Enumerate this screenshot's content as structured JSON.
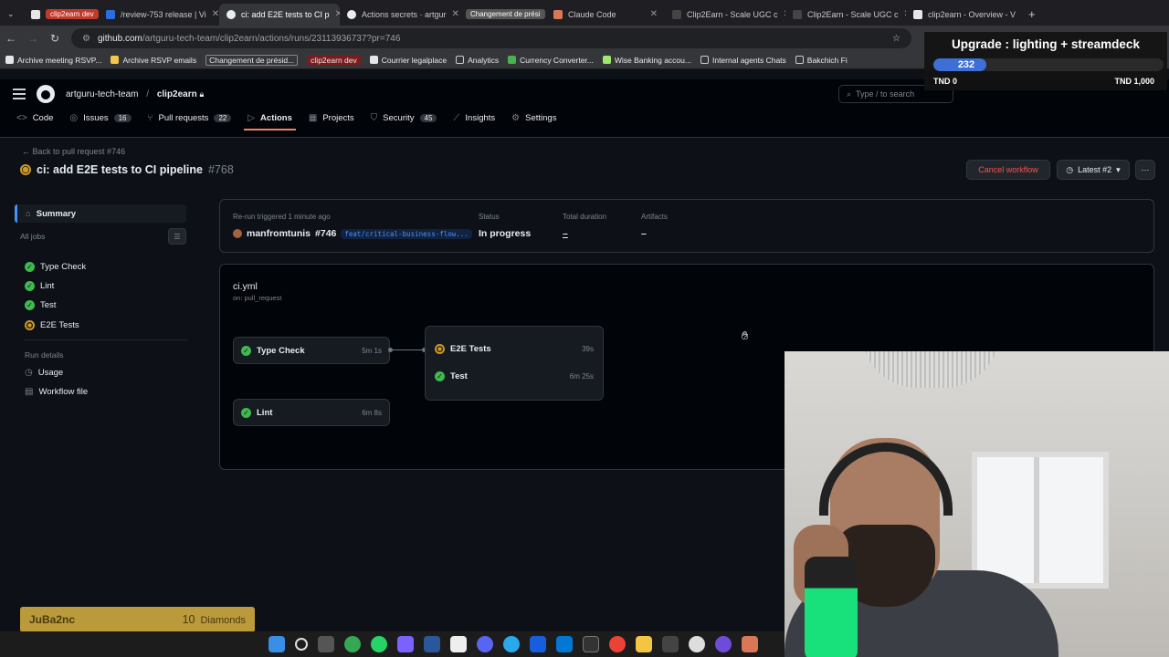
{
  "browser": {
    "tabs": [
      {
        "label": "clip2earn dev",
        "kind": "pill",
        "color": "#c0392b"
      },
      {
        "label": "/review-753 release | Vi",
        "kind": "tab",
        "color": "#2d6cdf"
      },
      {
        "label": "ci: add E2E tests to CI p",
        "kind": "active",
        "color": "#e6edf3"
      },
      {
        "label": "Actions secrets · artgur",
        "kind": "tab",
        "color": "#e6edf3"
      },
      {
        "label": "Changement de prési",
        "kind": "pill",
        "color": "#555"
      },
      {
        "label": "Claude Code",
        "kind": "tab",
        "color": "#d97757"
      },
      {
        "label": "Clip2Earn - Scale UGC c",
        "kind": "tab",
        "color": "#111"
      },
      {
        "label": "Clip2Earn - Scale UGC c",
        "kind": "tab",
        "color": "#111"
      },
      {
        "label": "clip2earn - Overview - V",
        "kind": "tab",
        "color": "#111"
      }
    ],
    "url_host": "github.com",
    "url_path": "/artguru-tech-team/clip2earn/actions/runs/23113936737?pr=746"
  },
  "bookmarks": [
    {
      "label": "Archive meeting RSVP...",
      "style": "plain"
    },
    {
      "label": "Archive RSVP emails",
      "style": "plain"
    },
    {
      "label": "Changement de présid...",
      "style": "boxed"
    },
    {
      "label": "clip2earn dev",
      "style": "red"
    },
    {
      "label": "Courrier legalplace",
      "style": "plain"
    },
    {
      "label": "Analytics",
      "style": "plain"
    },
    {
      "label": "Currency Converter...",
      "style": "plain"
    },
    {
      "label": "Wise Banking accou...",
      "style": "plain"
    },
    {
      "label": "Internal agents Chats",
      "style": "plain"
    },
    {
      "label": "Bakchich Fi",
      "style": "plain"
    }
  ],
  "github": {
    "owner": "artguru-tech-team",
    "repo": "clip2earn",
    "search_placeholder": "Type / to search",
    "nav": [
      {
        "label": "Code",
        "icon": "code-icon",
        "count": ""
      },
      {
        "label": "Issues",
        "icon": "issue-icon",
        "count": "16"
      },
      {
        "label": "Pull requests",
        "icon": "pull-request-icon",
        "count": "22"
      },
      {
        "label": "Actions",
        "icon": "play-icon",
        "count": ""
      },
      {
        "label": "Projects",
        "icon": "table-icon",
        "count": ""
      },
      {
        "label": "Security",
        "icon": "shield-icon",
        "count": "45"
      },
      {
        "label": "Insights",
        "icon": "graph-icon",
        "count": ""
      },
      {
        "label": "Settings",
        "icon": "gear-icon",
        "count": ""
      }
    ],
    "active_nav": "Actions"
  },
  "run": {
    "back_link": "Back to pull request #746",
    "title": "ci: add E2E tests to CI pipeline",
    "number": "#768",
    "cancel_label": "Cancel workflow",
    "latest_label": "Latest #2",
    "more_label": "···"
  },
  "sidebar": {
    "summary": "Summary",
    "all_jobs": "All jobs",
    "jobs": [
      {
        "label": "Type Check",
        "status": "success"
      },
      {
        "label": "Lint",
        "status": "success"
      },
      {
        "label": "Test",
        "status": "success"
      },
      {
        "label": "E2E Tests",
        "status": "in_progress"
      }
    ],
    "run_details": "Run details",
    "details": [
      {
        "label": "Usage",
        "icon": "clock-icon"
      },
      {
        "label": "Workflow file",
        "icon": "file-icon"
      }
    ]
  },
  "summary_panel": {
    "trigger_label": "Re-run triggered 1 minute ago",
    "actor": "manfromtunis",
    "pr": "#746",
    "branch": "feat/critical-business-flow...",
    "status_label": "Status",
    "status_value": "In progress",
    "duration_label": "Total duration",
    "duration_value": "–",
    "artifacts_label": "Artifacts",
    "artifacts_value": "–"
  },
  "graph": {
    "file": "ci.yml",
    "trigger": "on: pull_request",
    "nodes": {
      "type_check": {
        "label": "Type Check",
        "time": "5m 1s"
      },
      "lint": {
        "label": "Lint",
        "time": "6m 8s"
      },
      "e2e": {
        "label": "E2E Tests",
        "time": "39s"
      },
      "test": {
        "label": "Test",
        "time": "6m 25s"
      }
    }
  },
  "widget": {
    "title": "Upgrade : lighting + streamdeck",
    "value": "232",
    "min": "TND 0",
    "max": "TND 1,000",
    "progress": 0.232
  },
  "badge": {
    "user": "JuBa2nc",
    "count": "10",
    "unit": "Diamonds"
  },
  "colors": {
    "success": "#3fb950",
    "in_progress": "#d29922",
    "accent": "#f78166",
    "link": "#4493f8",
    "danger": "#f85149"
  }
}
